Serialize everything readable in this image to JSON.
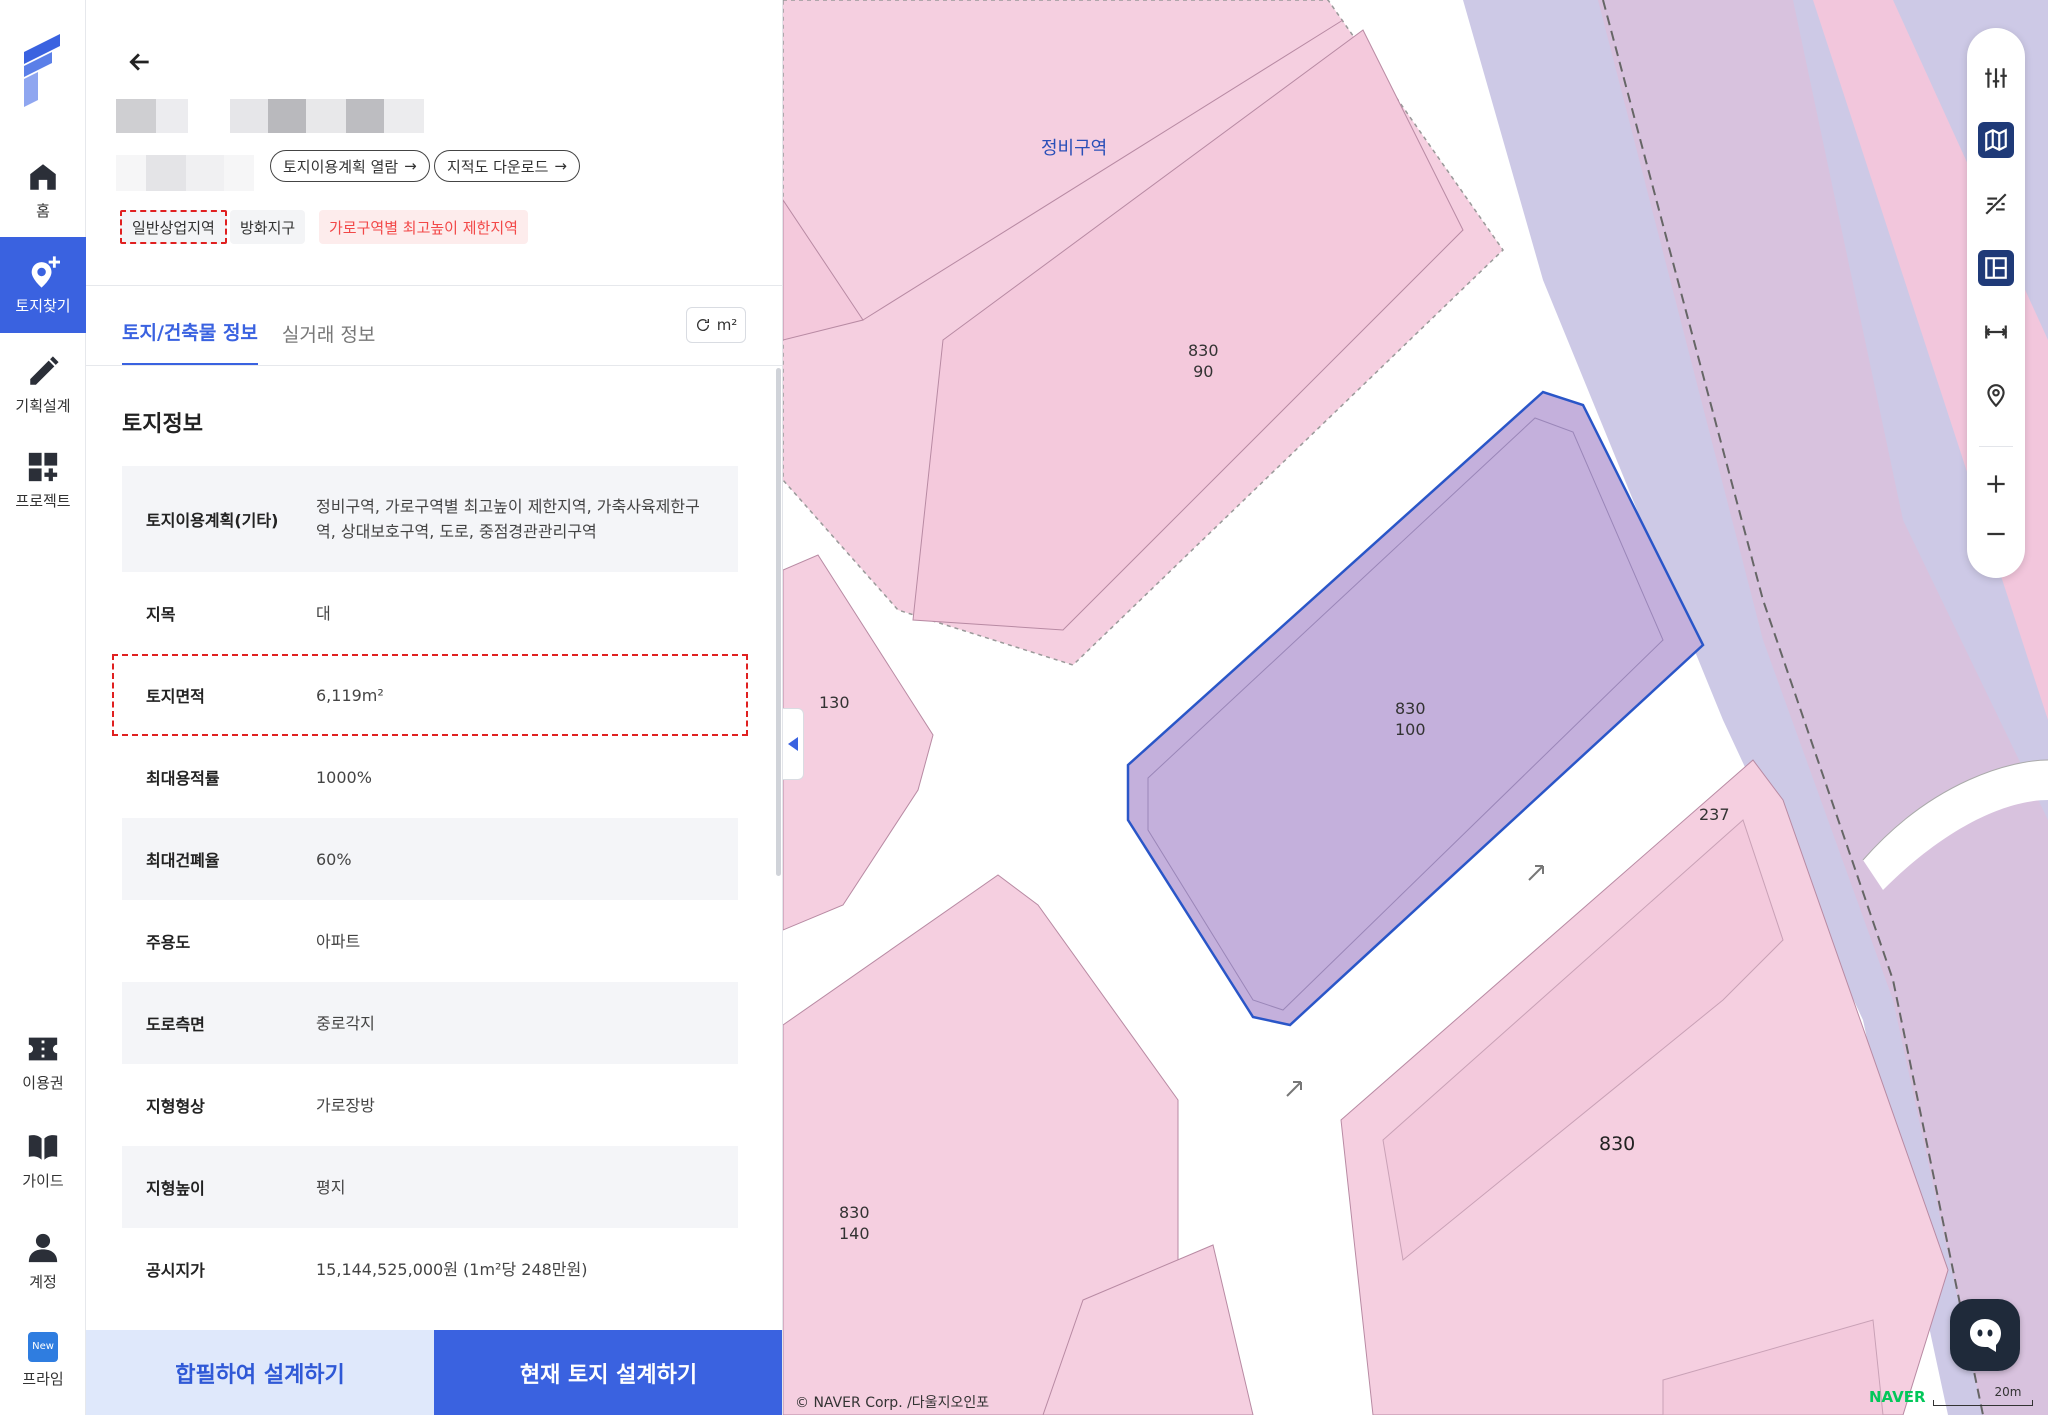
{
  "nav": {
    "items": [
      {
        "label": "홈",
        "icon": "home-icon"
      },
      {
        "label": "토지찾기",
        "icon": "map-pin-plus-icon",
        "active": true
      },
      {
        "label": "기획설계",
        "icon": "pencil-icon"
      },
      {
        "label": "프로젝트",
        "icon": "grid-plus-icon"
      },
      {
        "label": "이용권",
        "icon": "ticket-icon"
      },
      {
        "label": "가이드",
        "icon": "book-icon"
      },
      {
        "label": "계정",
        "icon": "person-icon"
      },
      {
        "label": "프라임",
        "icon": "new-badge-icon",
        "badge": "New"
      }
    ]
  },
  "panel": {
    "links": {
      "land_plan": "토지이용계획 열람",
      "cadastral_download": "지적도 다운로드"
    },
    "chips": {
      "zone": "일반상업지역",
      "fire": "방화지구",
      "limit": "가로구역별 최고높이 제한지역"
    },
    "tabs": [
      "토지/건축물 정보",
      "실거래 정보"
    ],
    "unit": "m²",
    "section_title": "토지정보",
    "rows": [
      {
        "label": "토지이용계획(기타)",
        "value": "정비구역, 가로구역별 최고높이 제한지역, 가축사육제한구역, 상대보호구역, 도로, 중점경관관리구역"
      },
      {
        "label": "지목",
        "value": "대"
      },
      {
        "label": "토지면적",
        "value": "6,119m²"
      },
      {
        "label": "최대용적률",
        "value": "1000%"
      },
      {
        "label": "최대건폐율",
        "value": "60%"
      },
      {
        "label": "주용도",
        "value": "아파트"
      },
      {
        "label": "도로측면",
        "value": "중로각지"
      },
      {
        "label": "지형형상",
        "value": "가로장방"
      },
      {
        "label": "지형높이",
        "value": "평지"
      },
      {
        "label": "공시지가",
        "value": "15,144,525,000원 (1m²당 248만원)"
      }
    ],
    "buttons": {
      "merge": "합필하여 설계하기",
      "design": "현재 토지 설계하기"
    }
  },
  "map": {
    "area_label": "정비구역",
    "parcels": [
      {
        "line1": "830",
        "line2": "90"
      },
      {
        "line1": "830",
        "line2": "100"
      },
      {
        "line1": "130",
        "line2": ""
      },
      {
        "line1": "237",
        "line2": ""
      },
      {
        "line1": "830",
        "line2": "140"
      },
      {
        "line1": "830",
        "line2": ""
      }
    ],
    "copyright": "© NAVER Corp. /다울지오인포",
    "naver": "NAVER",
    "scale": "20m",
    "toolbar": [
      "filter-sliders-icon",
      "map-layer-icon",
      "hide-layer-icon",
      "layout-icon",
      "measure-distance-icon",
      "location-pin-icon",
      "zoom-in-icon",
      "zoom-out-icon"
    ],
    "colors": {
      "zone_pink": "#f5cfe0",
      "selected": "#c4b0dc",
      "rail": "#cdc9e6"
    }
  }
}
